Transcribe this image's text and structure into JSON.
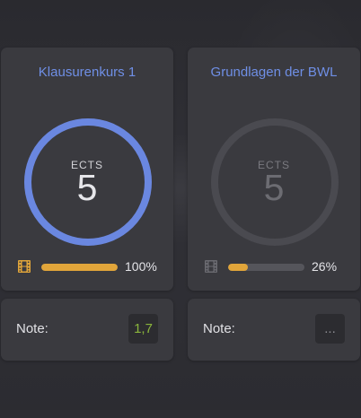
{
  "courses": [
    {
      "title": "Klausurenkurs 1",
      "ects_label": "ECTS",
      "ects_value": "5",
      "progress_percent": 100,
      "progress_text": "100%",
      "ring_color": "#6a87e0",
      "ring_progress": 1.0,
      "film_icon_color": "#e1a53a"
    },
    {
      "title": "Grundlagen der BWL",
      "ects_label": "ECTS",
      "ects_value": "5",
      "progress_percent": 26,
      "progress_text": "26%",
      "ring_color": "#4a4a50",
      "ring_progress": 0,
      "film_icon_color": "#6a6a70"
    }
  ],
  "notes": [
    {
      "label": "Note:",
      "grade": "1,7",
      "grade_color": "#8ab53c"
    },
    {
      "label": "Note:",
      "grade": "...",
      "grade_color": "#8c8c92"
    }
  ],
  "colors": {
    "accent_blue": "#6f8fe6",
    "progress_orange": "#e1a53a",
    "card_bg": "#3a3a3f",
    "page_bg": "#2b2b30"
  },
  "icons": {
    "film": "film-icon"
  }
}
